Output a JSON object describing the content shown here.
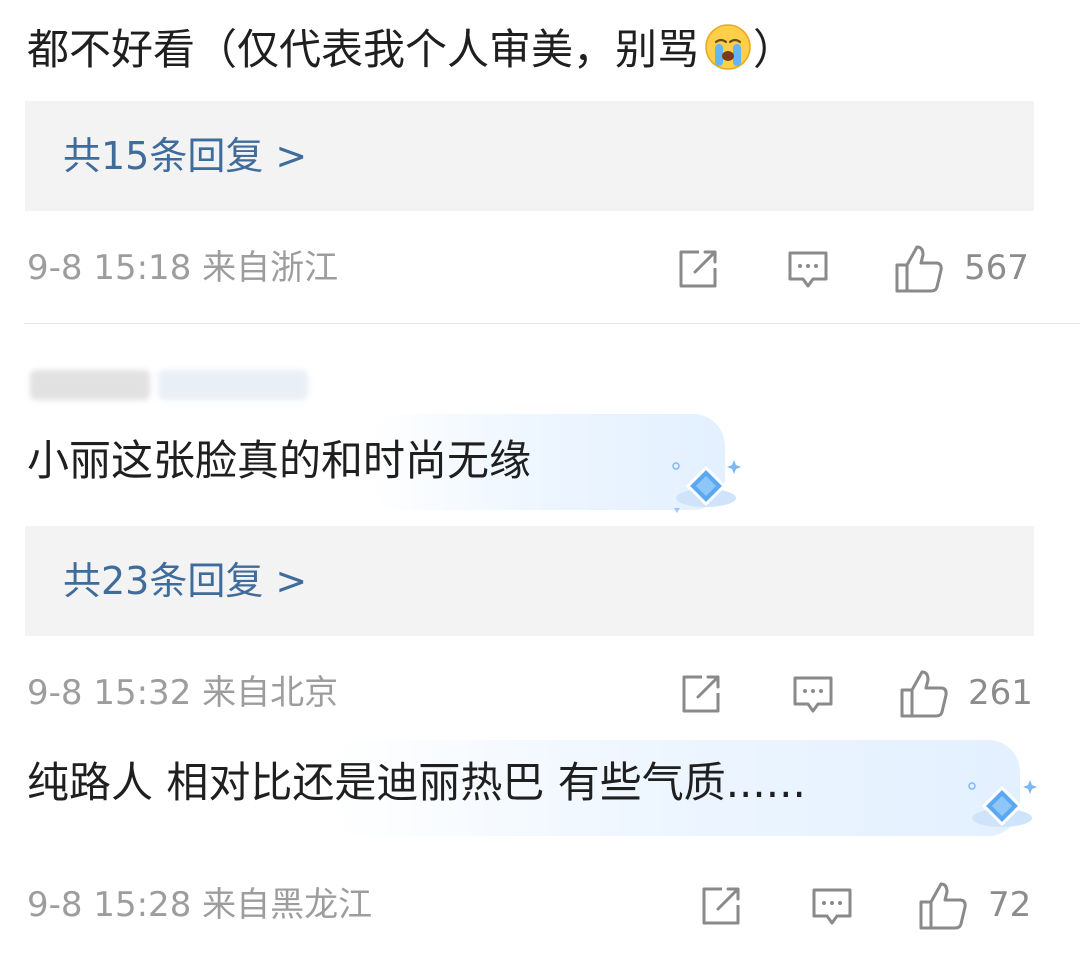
{
  "comments": [
    {
      "text": "都不好看（仅代表我个人审美，别骂",
      "text_tail": "）",
      "emoji": "crying-face-emoji",
      "replies_label": "共15条回复 >",
      "time": "9-8 15:18",
      "location": "来自浙江",
      "likes": "567"
    },
    {
      "text": "小丽这张脸真的和时尚无缘",
      "replies_label": "共23条回复 >",
      "time": "9-8 15:32",
      "location": "来自北京",
      "likes": "261"
    },
    {
      "text": "纯路人 相对比还是迪丽热巴 有些气质......",
      "time": "9-8 15:28",
      "location": "来自黑龙江",
      "likes": "72"
    }
  ],
  "icons": {
    "share": "share-icon",
    "comment": "comment-icon",
    "like": "like-icon",
    "bubble_decoration": "diamond-gem-icon"
  },
  "colors": {
    "reply_link": "#3f6c9a",
    "meta_text": "#9d9d9d",
    "reply_box_bg": "#f3f3f4"
  }
}
